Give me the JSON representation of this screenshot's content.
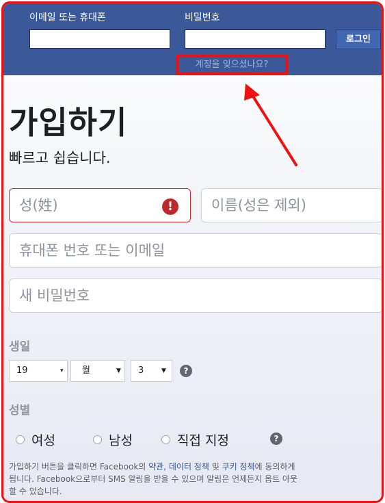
{
  "header": {
    "email_label": "이메일 또는 휴대폰",
    "password_label": "비밀번호",
    "login_button": "로그인",
    "forgot_link": "계정을 잊으셨나요?"
  },
  "signup": {
    "title": "가입하기",
    "subtitle": "빠르고 쉽습니다.",
    "last_name_placeholder": "성(姓)",
    "first_name_placeholder": "이름(성은 제외)",
    "contact_placeholder": "휴대폰 번호 또는 이메일",
    "password_placeholder": "새 비밀번호",
    "error_icon_glyph": "!",
    "birthday_label": "생일",
    "birthday_year": "19",
    "birthday_month": "월",
    "birthday_day": "3",
    "gender_label": "성별",
    "gender_female": "여성",
    "gender_male": "남성",
    "gender_custom": "직접 지정",
    "help_glyph": "?",
    "terms_1": "가입하기 버튼을 클릭하면 Facebook의 ",
    "terms_link_terms": "약관",
    "terms_2": ", ",
    "terms_link_data": "데이터 정책",
    "terms_3": " 및 ",
    "terms_link_cookie": "쿠키 정책",
    "terms_4": "에 동의하게 됩니다. Facebook으로부터 SMS 알림을 받을 수 있으며 알림은 언제든지 옵트 아웃할 수 있습니다."
  },
  "colors": {
    "header_bg": "#3b5998",
    "highlight": "#ee1111",
    "error": "#be2a2a"
  }
}
